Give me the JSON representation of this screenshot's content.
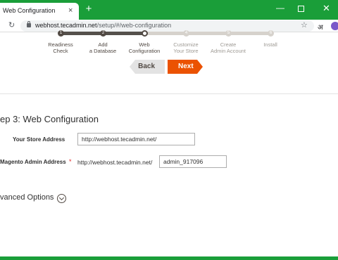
{
  "browser": {
    "tab_title": "Web Configuration",
    "tab_close": "×",
    "new_tab": "+",
    "url_host": "webhost.tecadmin.net",
    "url_path": "/setup/#/web-configuration",
    "extension_glyph": "अ"
  },
  "progress": {
    "completed_fraction": 0.4,
    "steps": [
      {
        "number": "1",
        "label_line1": "Readiness",
        "label_line2": "Check",
        "state": "done"
      },
      {
        "number": "2",
        "label_line1": "Add",
        "label_line2": "a Database",
        "state": "done"
      },
      {
        "number": "3",
        "label_line1": "Web",
        "label_line2": "Configuration",
        "state": "current"
      },
      {
        "number": "4",
        "label_line1": "Customize",
        "label_line2": "Your Store",
        "state": "todo"
      },
      {
        "number": "5",
        "label_line1": "Create",
        "label_line2": "Admin Account",
        "state": "todo"
      },
      {
        "number": "6",
        "label_line1": "Install",
        "label_line2": "",
        "state": "todo"
      }
    ]
  },
  "nav": {
    "back_label": "Back",
    "next_label": "Next"
  },
  "form": {
    "title": "ep 3: Web Configuration",
    "store_address_label": "Your Store Address",
    "store_address_value": "http://webhost.tecadmin.net/",
    "admin_address_label": "Magento Admin Address",
    "required_mark": "*",
    "admin_prefix": "http://webhost.tecadmin.net/",
    "admin_path_value": "admin_917096",
    "advanced_label": "vanced Options"
  },
  "colors": {
    "chrome_green": "#1a9e39",
    "next_orange": "#eb5202",
    "step_dark": "#514943"
  }
}
